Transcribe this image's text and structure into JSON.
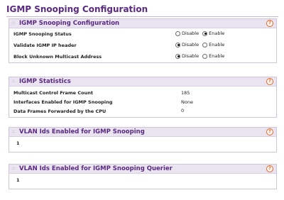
{
  "page": {
    "title": "IGMP Snooping Configuration"
  },
  "config_panel": {
    "title": "IGMP Snooping Configuration",
    "rows": [
      {
        "label": "IGMP Snooping Status",
        "options": [
          "Disable",
          "Enable"
        ],
        "selected": "Enable"
      },
      {
        "label": "Validate IGMP IP header",
        "options": [
          "Disable",
          "Enable"
        ],
        "selected": "Disable"
      },
      {
        "label": "Block Unknown Multicast Address",
        "options": [
          "Disable",
          "Enable"
        ],
        "selected": "Disable"
      }
    ]
  },
  "stats_panel": {
    "title": "IGMP Statistics",
    "rows": [
      {
        "label": "Multicast Control Frame Count",
        "value": "185"
      },
      {
        "label": "Interfaces Enabled for IGMP Snooping",
        "value": "None"
      },
      {
        "label": "Data Frames Forwarded by the CPU",
        "value": "0"
      }
    ]
  },
  "vlan_panel": {
    "title": "VLAN Ids Enabled for IGMP Snooping",
    "value": "1"
  },
  "querier_panel": {
    "title": "VLAN Ids Enabled for IGMP Snooping Querier",
    "value": "1"
  },
  "icons": {
    "help": "?",
    "grip": "::"
  },
  "colors": {
    "title": "#5a2a82",
    "help": "#e06a2c",
    "header_bg": "#e9e4ef"
  }
}
